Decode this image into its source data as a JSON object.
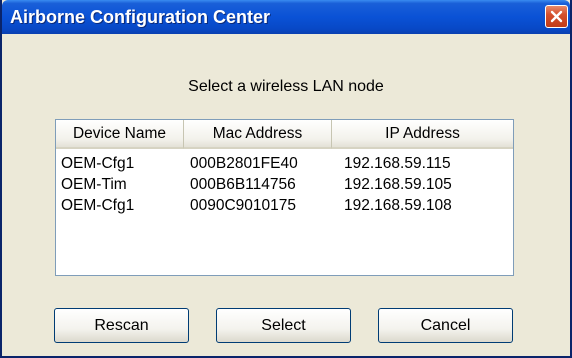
{
  "window": {
    "title": "Airborne Configuration Center",
    "close_icon": "close-x-icon"
  },
  "prompt": "Select a wireless LAN node",
  "list": {
    "columns": [
      "Device Name",
      "Mac Address",
      "IP Address"
    ],
    "rows": [
      [
        "OEM-Cfg1",
        "000B2801FE40",
        "192.168.59.115"
      ],
      [
        "OEM-Tim",
        "000B6B114756",
        "192.168.59.105"
      ],
      [
        "OEM-Cfg1",
        "0090C9010175",
        "192.168.59.108"
      ]
    ]
  },
  "buttons": {
    "rescan": "Rescan",
    "select": "Select",
    "cancel": "Cancel"
  },
  "colors": {
    "titlebar": "#0a52d6",
    "window_bg": "#ece9d8",
    "close_button": "#c23b17"
  }
}
